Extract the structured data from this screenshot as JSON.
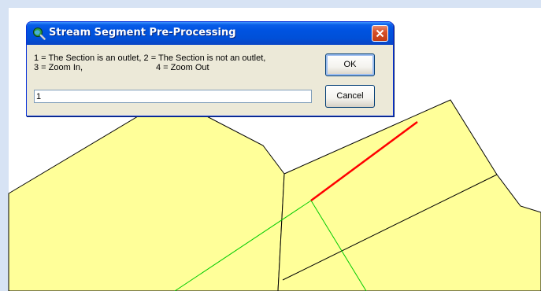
{
  "dialog": {
    "title": "Stream Segment Pre-Processing",
    "message_line1": "1 = The Section is an outlet, 2 = The Section is not an outlet,",
    "message_line2_left": "3 = Zoom In,",
    "message_line2_right": "4 = Zoom Out",
    "input_value": "1",
    "ok_label": "OK",
    "cancel_label": "Cancel"
  },
  "colors": {
    "desktop_background": "#d7e3f4",
    "polygon_fill": "#ffff99",
    "polygon_outline": "#000000",
    "selected_segment": "#ff0000",
    "stream_lines": "#00cc00",
    "titlebar_blue": "#0053e1"
  },
  "icons": {
    "title_icon": "magnifier-globe-icon",
    "close": "close-icon"
  }
}
